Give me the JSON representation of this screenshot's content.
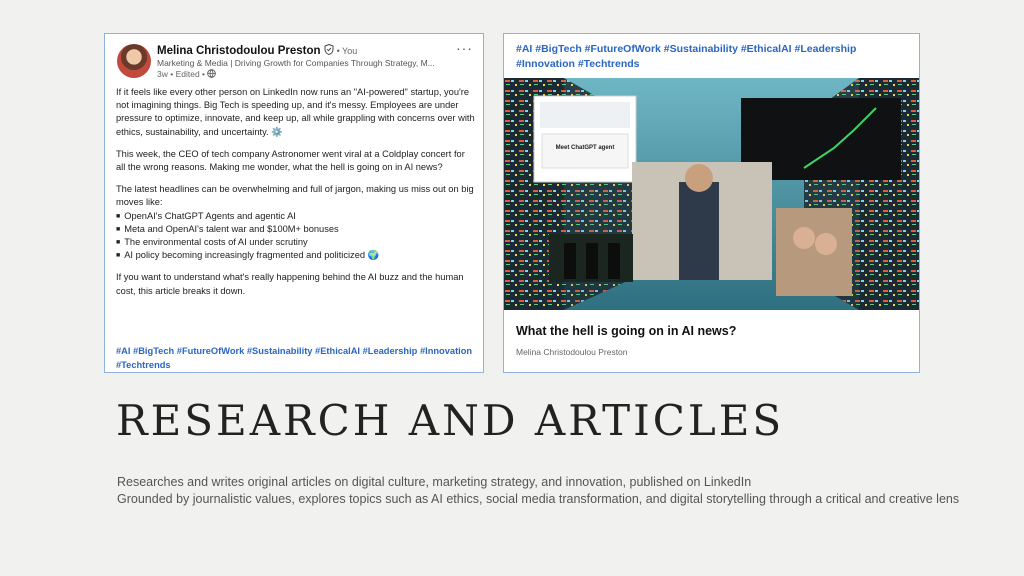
{
  "post": {
    "author": "Melina Christodoulou Preston",
    "you": "• You",
    "headline": "Marketing & Media | Driving Growth for Companies Through Strategy, M...",
    "meta": "3w • Edited •",
    "more": "···",
    "paragraphs": [
      "If it feels like every other person on LinkedIn now runs an \"AI-powered\" startup, you're not imagining things. Big Tech is speeding up, and it's messy. Employees are under pressure to optimize, innovate, and keep up, all while grappling with concerns over with ethics, sustainability, and uncertainty. ⚙️",
      "This week, the CEO of tech company Astronomer went viral at a Coldplay concert for all the wrong reasons. Making me wonder, what the hell is going on in AI news?",
      "The latest headlines can be overwhelming and full of jargon, making us miss out on big moves like:"
    ],
    "bullets": [
      "OpenAI's ChatGPT Agents and agentic AI",
      "Meta and OpenAI's talent war and $100M+ bonuses",
      "The environmental costs of AI under scrutiny",
      "AI policy becoming increasingly fragmented and politicized 🌍"
    ],
    "closing": "If you want to understand what's really happening behind the AI buzz and the human cost, this article breaks it down.",
    "hashtags": "#AI #BigTech #FutureOfWork #Sustainability #EthicalAI #Leadership #Innovation #Techtrends"
  },
  "article": {
    "hashtags": "#AI #BigTech #FutureOfWork #Sustainability #EthicalAI #Leadership #Innovation #Techtrends",
    "image_caption": "Meet ChatGPT agent",
    "title": "What the hell is going on in AI news?",
    "author": "Melina Christodoulou Preston"
  },
  "section": {
    "title": "RESEARCH AND ARTICLES",
    "desc_line1": "Researches and writes original articles on digital culture, marketing strategy, and innovation, published on LinkedIn",
    "desc_line2": "Grounded by journalistic values,  explores topics such as AI ethics, social media transformation, and digital storytelling through a critical and creative lens"
  },
  "colors": {
    "hashtag": "#2a66c2",
    "card_border": "#8fb3dd",
    "background": "#f1f1ef"
  },
  "icons": [
    "verified-icon",
    "globe-icon",
    "more-icon"
  ]
}
